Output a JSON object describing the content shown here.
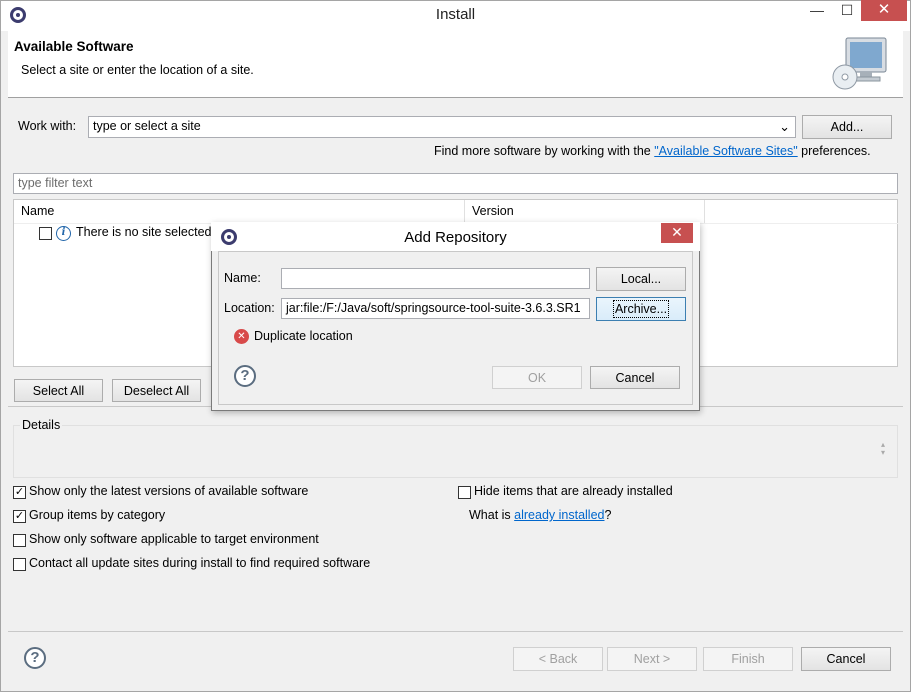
{
  "window": {
    "title": "Install",
    "minimize_glyph": "—",
    "maximize_glyph": "☐",
    "close_glyph": "✕"
  },
  "banner": {
    "title": "Available Software",
    "subtitle": "Select a site or enter the location of a site."
  },
  "work_with": {
    "label": "Work with:",
    "placeholder": "type or select a site",
    "dropdown_glyph": "⌄",
    "add_button": "Add...",
    "find_more_prefix": "Find more software by working with the ",
    "find_more_link": "\"Available Software Sites\"",
    "find_more_suffix": " preferences."
  },
  "filter": {
    "placeholder": "type filter text"
  },
  "table": {
    "columns": [
      "Name",
      "Version"
    ],
    "rows": [
      {
        "checked": false,
        "icon": "info-icon",
        "text": "There is no site selected."
      }
    ]
  },
  "selection_buttons": {
    "select_all": "Select All",
    "deselect_all": "Deselect All"
  },
  "details": {
    "label": "Details"
  },
  "options": {
    "latest_versions": {
      "label": "Show only the latest versions of available software",
      "checked": true
    },
    "group_by_category": {
      "label": "Group items by category",
      "checked": true
    },
    "target_env": {
      "label": "Show only software applicable to target environment",
      "checked": false
    },
    "contact_sites": {
      "label": "Contact all update sites during install to find required software",
      "checked": false
    },
    "hide_installed": {
      "label": "Hide items that are already installed",
      "checked": false
    },
    "what_is_prefix": "What is ",
    "what_is_link": "already installed",
    "what_is_suffix": "?"
  },
  "footer": {
    "back": "< Back",
    "next": "Next >",
    "finish": "Finish",
    "cancel": "Cancel"
  },
  "dialog": {
    "title": "Add Repository",
    "close_glyph": "✕",
    "name_label": "Name:",
    "name_value": "",
    "location_label": "Location:",
    "location_value": "jar:file:/F:/Java/soft/springsource-tool-suite-3.6.3.SR1",
    "local_button": "Local...",
    "archive_button": "Archive...",
    "error_message": "Duplicate location",
    "ok_button": "OK",
    "cancel_button": "Cancel"
  },
  "colors": {
    "accent_link": "#0066cc",
    "close_red": "#c75050",
    "error_red": "#d84a4a"
  }
}
